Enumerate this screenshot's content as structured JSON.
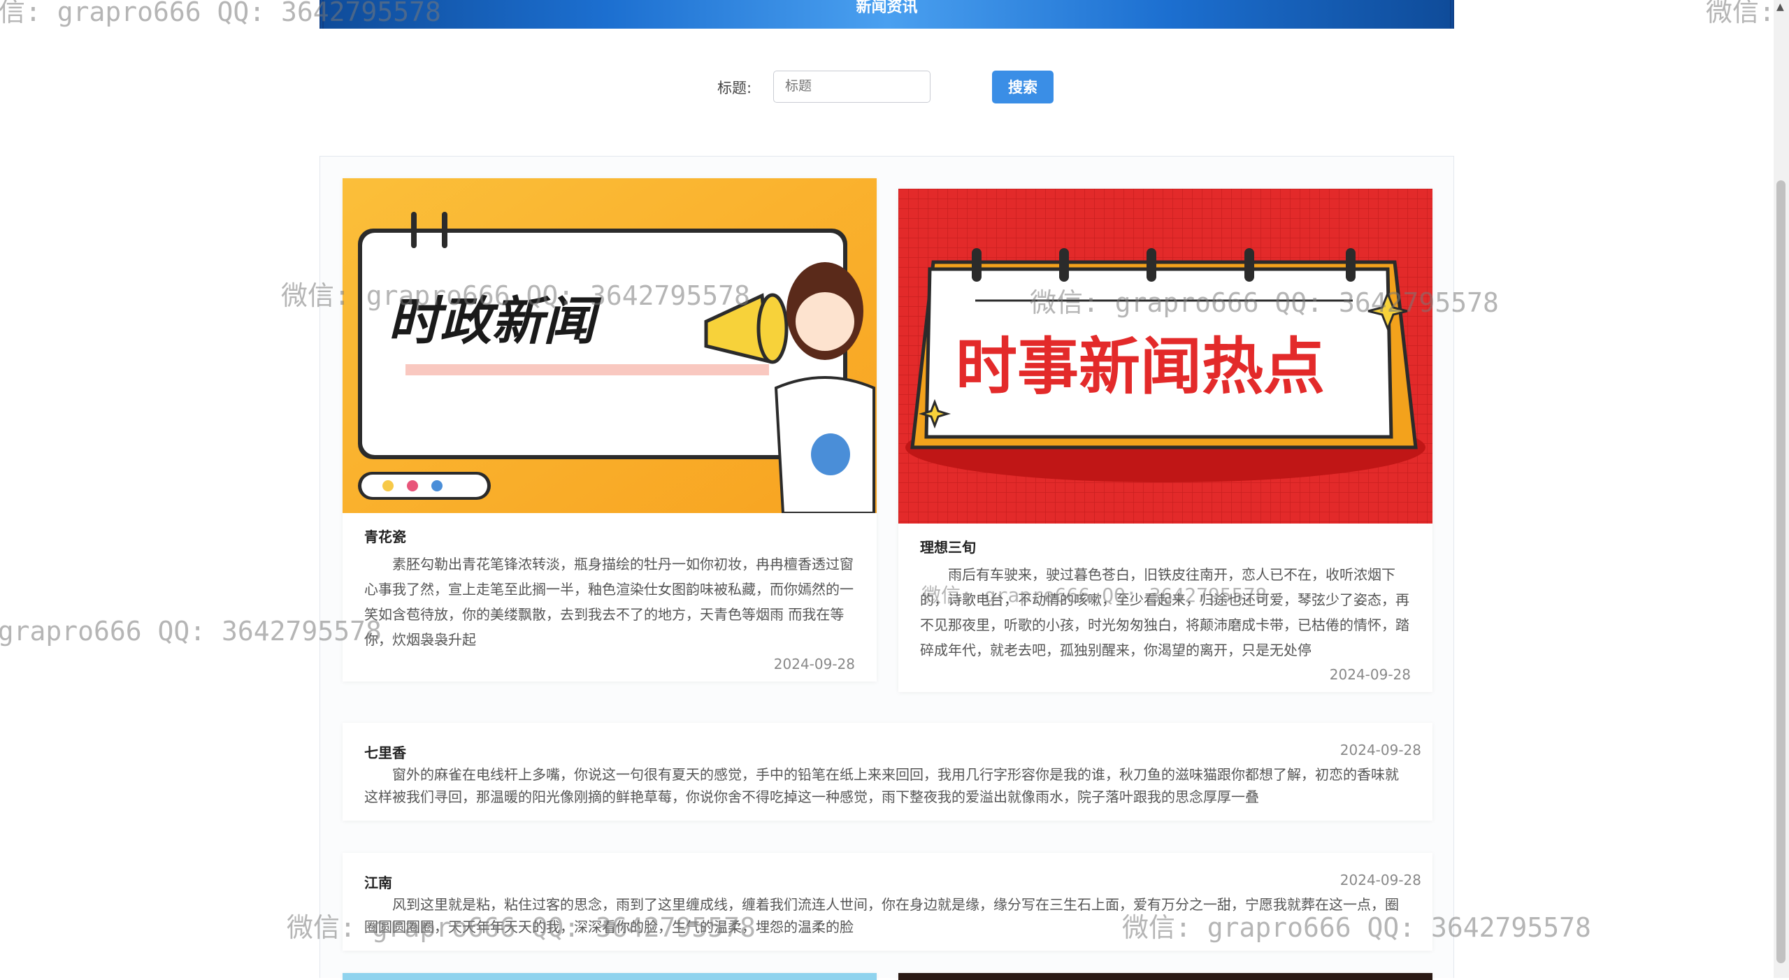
{
  "header": {
    "title": "新闻资讯"
  },
  "search": {
    "label": "标题:",
    "placeholder": "标题",
    "button": "搜索"
  },
  "featured": [
    {
      "image_text": "时政新闻",
      "title": "青花瓷",
      "content": "素胚勾勒出青花笔锋浓转淡，瓶身描绘的牡丹一如你初妆，冉冉檀香透过窗心事我了然，宣上走笔至此搁一半，釉色渲染仕女图韵味被私藏，而你嫣然的一笑如含苞待放，你的美缕飘散，去到我去不了的地方，天青色等烟雨 而我在等你，炊烟袅袅升起",
      "date": "2024-09-28"
    },
    {
      "image_text": "时事新闻热点",
      "title": "理想三旬",
      "content": "雨后有车驶来，驶过暮色苍白，旧铁皮往南开，恋人已不在，收听浓烟下的，诗歌电台，不动情的咳嗽，至少看起来，归途也还可爱，琴弦少了姿态，再不见那夜里，听歌的小孩，时光匆匆独白，将颠沛磨成卡带，已枯倦的情怀，踏碎成年代，就老去吧，孤独别醒来，你渴望的离开，只是无处停",
      "date": "2024-09-28"
    }
  ],
  "list": [
    {
      "title": "七里香",
      "content": "窗外的麻雀在电线杆上多嘴，你说这一句很有夏天的感觉，手中的铅笔在纸上来来回回，我用几行字形容你是我的谁，秋刀鱼的滋味猫跟你都想了解，初恋的香味就这样被我们寻回，那温暖的阳光像刚摘的鲜艳草莓，你说你舍不得吃掉这一种感觉，雨下整夜我的爱溢出就像雨水，院子落叶跟我的思念厚厚一叠",
      "date": "2024-09-28"
    },
    {
      "title": "江南",
      "content": "风到这里就是粘，粘住过客的思念，雨到了这里缠成线，缠着我们流连人世间，你在身边就是缘，缘分写在三生石上面，爱有万分之一甜，宁愿我就葬在这一点，圈圈圆圆圈圈，天天年年天天的我，深深看你的脸，生气的温柔，埋怨的温柔的脸",
      "date": "2024-09-28"
    }
  ],
  "watermark": "微信: grapro666 QQ: 3642795578",
  "colors": {
    "accent": "#3a8ee6",
    "header": "#1c6fd0"
  }
}
